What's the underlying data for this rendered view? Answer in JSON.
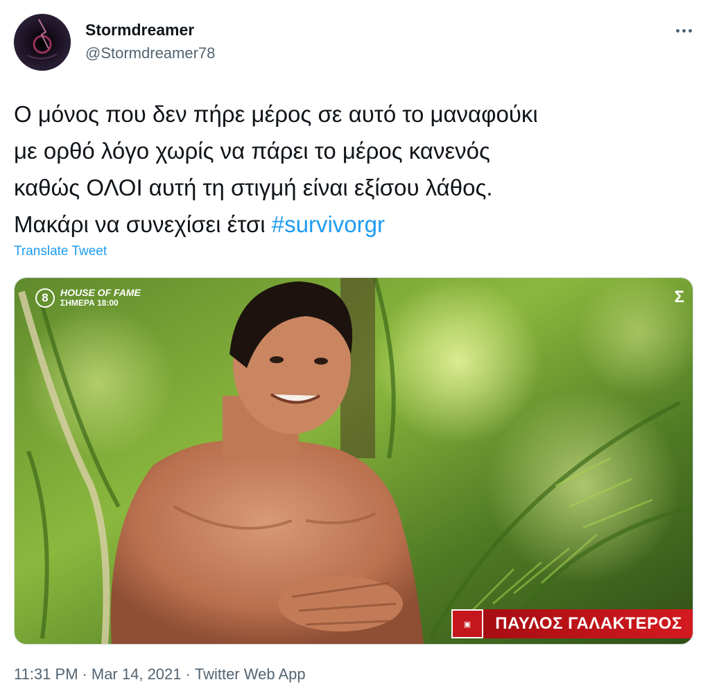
{
  "author": {
    "display_name": "Stormdreamer",
    "handle": "@Stormdreamer78",
    "avatar_icon": "avatar-icon"
  },
  "more_icon": "more-options-icon",
  "tweet": {
    "lines": [
      "Ο μόνος που δεν πήρε μέρος σε αυτό το μαναφούκι",
      "με ορθό λόγο χωρίς να πάρει το μέρος κανενός",
      "καθώς ΟΛΟΙ αυτή τη στιγμή είναι εξίσου λάθος."
    ],
    "last_line_text": "Μακάρι να συνεχίσει έτσι ",
    "hashtag": "#survivorgr"
  },
  "translate_label": "Translate Tweet",
  "media": {
    "channel": "8",
    "promo_title": "HOUSE OF FAME",
    "promo_time": "ΣΗΜΕΡΑ 18:00",
    "corner_logo": "Σ",
    "lower_third_name": "ΠΑΥΛΟΣ ΓΑΛΑΚΤΕΡΟΣ"
  },
  "meta": {
    "time": "11:31 PM",
    "sep1": "·",
    "date": "Mar 14, 2021",
    "sep2": "·",
    "app": "Twitter Web App"
  },
  "colors": {
    "link": "#1d9bf0",
    "secondary_text": "#536471",
    "primary_text": "#0f1419",
    "lower_third_red": "#c4161c"
  }
}
